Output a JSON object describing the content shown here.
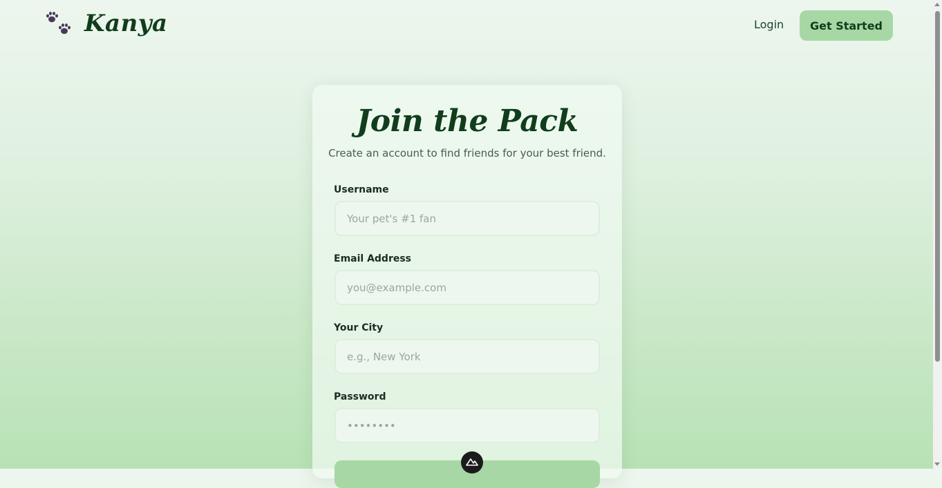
{
  "header": {
    "brand": "Kanya",
    "logo_icon": "paw-prints-icon",
    "nav": {
      "login_label": "Login",
      "cta_label": "Get Started"
    }
  },
  "signup": {
    "title": "Join the Pack",
    "subtitle": "Create an account to find friends for your best friend.",
    "fields": [
      {
        "label": "Username",
        "placeholder": "Your pet's #1 fan",
        "value": ""
      },
      {
        "label": "Email Address",
        "placeholder": "you@example.com",
        "value": ""
      },
      {
        "label": "Your City",
        "placeholder": "e.g., New York",
        "value": ""
      },
      {
        "label": "Password",
        "placeholder": "••••••••",
        "value": ""
      }
    ]
  },
  "colors": {
    "brand_dark_green": "#113d1c",
    "accent_green": "#a6d7a4",
    "paw_purple": "#4a3a5a"
  }
}
